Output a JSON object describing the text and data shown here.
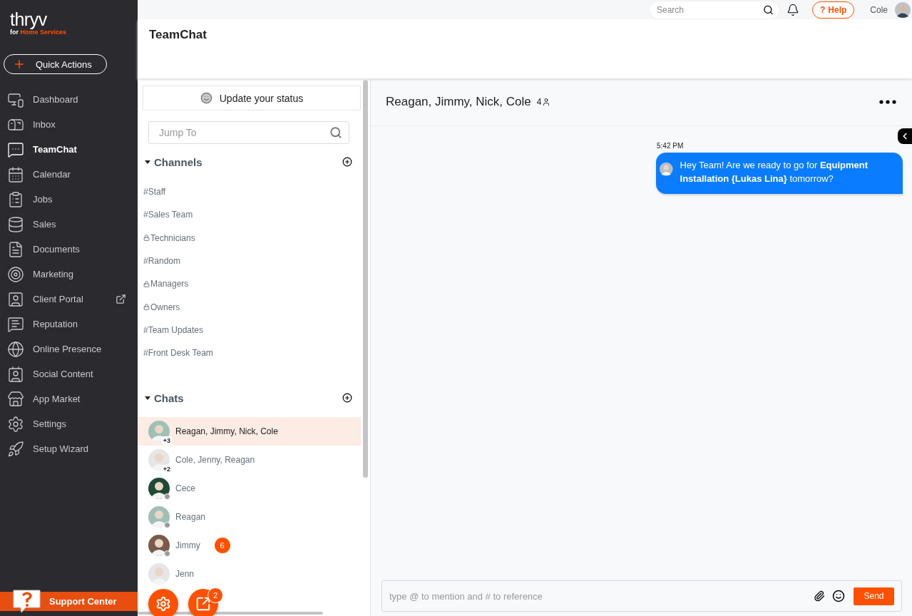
{
  "sidebar": {
    "logo": {
      "wordmark": "thryv",
      "tagline_prefix": "for",
      "tagline_highlight": "Home Services"
    },
    "quick_action": "Quick Actions",
    "items": [
      {
        "label": "Dashboard",
        "selected": false
      },
      {
        "label": "Inbox",
        "selected": false
      },
      {
        "label": "TeamChat",
        "selected": true
      },
      {
        "label": "Calendar",
        "selected": false
      },
      {
        "label": "Jobs",
        "selected": false
      },
      {
        "label": "Sales",
        "selected": false
      },
      {
        "label": "Documents",
        "selected": false
      },
      {
        "label": "Marketing",
        "selected": false
      },
      {
        "label": "Client Portal",
        "selected": false,
        "external": true
      },
      {
        "label": "Reputation",
        "selected": false
      },
      {
        "label": "Online Presence",
        "selected": false
      },
      {
        "label": "Social Content",
        "selected": false
      },
      {
        "label": "App Market",
        "selected": false
      },
      {
        "label": "Settings",
        "selected": false
      },
      {
        "label": "Setup Wizard",
        "selected": false
      }
    ],
    "support": "Support Center"
  },
  "topbar": {
    "search": {
      "placeholder": "Search"
    },
    "help": {
      "mark": "?",
      "label": "Help"
    },
    "user": "Cole"
  },
  "page_title": "TeamChat",
  "chat_list": {
    "status_button": "Update your status",
    "jump": {
      "placeholder": "Jump To"
    },
    "channels": {
      "title": "Channels",
      "expanded": true,
      "items": [
        {
          "label": "#Staff",
          "private": false
        },
        {
          "label": "#Sales Team",
          "private": false
        },
        {
          "label": "Technicians",
          "private": true
        },
        {
          "label": "#Random",
          "private": false
        },
        {
          "label": "Managers",
          "private": true
        },
        {
          "label": "Owners",
          "private": true
        },
        {
          "label": "#Team Updates",
          "private": false
        },
        {
          "label": "#Front Desk Team",
          "private": false
        }
      ]
    },
    "chats": {
      "title": "Chats",
      "expanded": true,
      "items": [
        {
          "name": "Reagan, Jimmy, Nick, Cole",
          "kind": "group",
          "extra": "+3",
          "selected": true
        },
        {
          "name": "Cole, Jenny, Reagan",
          "kind": "group",
          "extra": "+2",
          "selected": false
        },
        {
          "name": "Cece",
          "kind": "person",
          "online": false,
          "selected": false
        },
        {
          "name": "Reagan",
          "kind": "person",
          "online": false,
          "selected": false
        },
        {
          "name": "Jimmy",
          "kind": "person",
          "online": false,
          "unread": "6",
          "selected": false
        },
        {
          "name": "Jenn",
          "kind": "person",
          "selected": false
        }
      ]
    },
    "fab_badge": "2"
  },
  "conversation": {
    "title": "Reagan, Jimmy, Nick, Cole",
    "member_count": "4",
    "messages": [
      {
        "time": "5:42 PM",
        "text": "Hey Team! Are we ready to go for **Equipment Installation {Lukas Lina}** tomorrow?"
      }
    ],
    "composer": {
      "placeholder": "type @ to mention and # to reference",
      "send": "Send"
    }
  }
}
